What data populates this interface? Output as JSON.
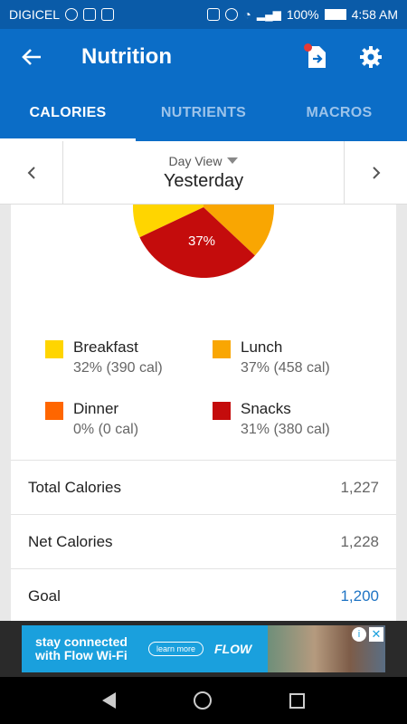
{
  "status_bar": {
    "carrier": "DIGICEL",
    "battery": "100%",
    "time": "4:58 AM"
  },
  "app_bar": {
    "title": "Nutrition"
  },
  "tabs": [
    {
      "label": "CALORIES",
      "active": true
    },
    {
      "label": "NUTRIENTS",
      "active": false
    },
    {
      "label": "MACROS",
      "active": false
    }
  ],
  "day_bar": {
    "view_label": "Day View",
    "day": "Yesterday"
  },
  "pie": {
    "slices": [
      {
        "name": "Breakfast",
        "percent": 32,
        "color": "#ffd500"
      },
      {
        "name": "Lunch",
        "percent": 37,
        "color": "#f9a602"
      },
      {
        "name": "Dinner",
        "percent": 0,
        "color": "#ff6600"
      },
      {
        "name": "Snacks",
        "percent": 31,
        "color": "#c40c0c"
      }
    ],
    "center_label": "37%"
  },
  "legend": [
    {
      "name": "Breakfast",
      "value": "32% (390 cal)",
      "color": "#ffd500"
    },
    {
      "name": "Lunch",
      "value": "37% (458 cal)",
      "color": "#f9a602"
    },
    {
      "name": "Dinner",
      "value": "0% (0 cal)",
      "color": "#ff6600"
    },
    {
      "name": "Snacks",
      "value": "31% (380 cal)",
      "color": "#c40c0c"
    }
  ],
  "summary": [
    {
      "label": "Total Calories",
      "value": "1,227"
    },
    {
      "label": "Net Calories",
      "value": "1,228"
    },
    {
      "label": "Goal",
      "value": "1,200"
    }
  ],
  "ad": {
    "line1": "stay connected",
    "line2": "with Flow Wi-Fi",
    "button": "learn more",
    "brand": "FLOW"
  }
}
